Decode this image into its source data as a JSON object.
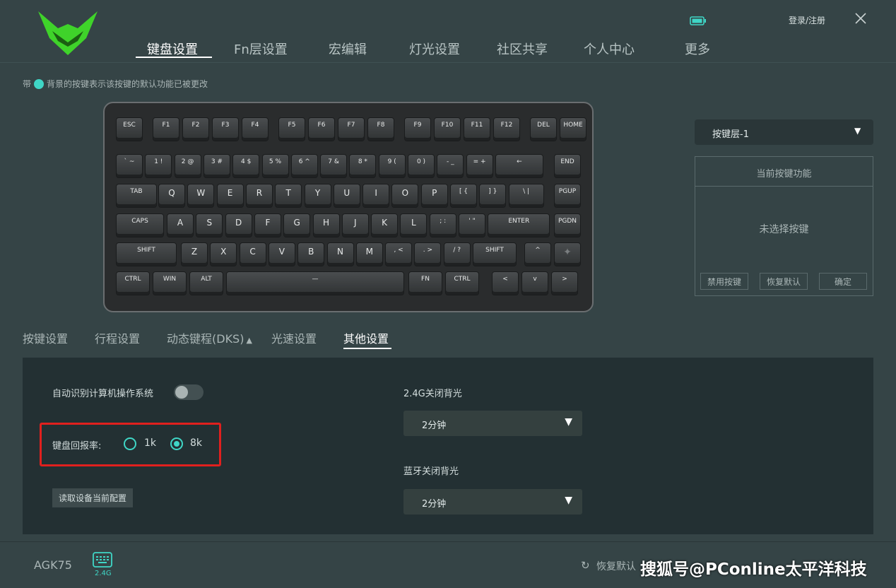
{
  "header": {
    "nav": [
      "键盘设置",
      "Fn层设置",
      "宏编辑",
      "灯光设置",
      "社区共享",
      "个人中心",
      "更多"
    ],
    "login": "登录/注册",
    "battery_icon": "battery-icon",
    "close_icon": "close-icon"
  },
  "hint": {
    "prefix": "带",
    "text": "背景的按键表示该按键的默认功能已被更改"
  },
  "keyboard": {
    "row0": [
      "ESC",
      "F1",
      "F2",
      "F3",
      "F4",
      "F5",
      "F6",
      "F7",
      "F8",
      "F9",
      "F10",
      "F11",
      "F12",
      "DEL",
      "HOME"
    ],
    "row1": [
      "` ~",
      "1 !",
      "2 @",
      "3 #",
      "4 $",
      "5 %",
      "6 ^",
      "7 &",
      "8 *",
      "9 (",
      "0 )",
      "- _",
      "= +",
      "←",
      "END"
    ],
    "row2": [
      "TAB",
      "Q",
      "W",
      "E",
      "R",
      "T",
      "Y",
      "U",
      "I",
      "O",
      "P",
      "[ {",
      "] }",
      "\\ |",
      "PGUP"
    ],
    "row3": [
      "CAPS",
      "A",
      "S",
      "D",
      "F",
      "G",
      "H",
      "J",
      "K",
      "L",
      "; :",
      "' \"",
      "ENTER",
      "PGDN"
    ],
    "row4": [
      "SHIFT",
      "Z",
      "X",
      "C",
      "V",
      "B",
      "N",
      "M",
      ", <",
      ". >",
      "/ ?",
      "SHIFT",
      "^"
    ],
    "row5": [
      "CTRL",
      "WIN",
      "ALT",
      "—",
      "FN",
      "CTRL",
      "<",
      "v",
      ">"
    ]
  },
  "right_panel": {
    "layer": "按键层-1",
    "func_title": "当前按键功能",
    "func_empty": "未选择按键",
    "btn_disable": "禁用按键",
    "btn_restore": "恢复默认",
    "btn_confirm": "确定"
  },
  "subtabs": [
    "按键设置",
    "行程设置",
    "动态键程(DKS)",
    "光速设置",
    "其他设置"
  ],
  "settings": {
    "auto_os": "自动识别计算机操作系统",
    "auto_os_on": false,
    "rate_label": "键盘回报率:",
    "rate_options": [
      "1k",
      "8k"
    ],
    "rate_selected": "8k",
    "read_config": "读取设备当前配置",
    "bl24_label": "2.4G关闭背光",
    "bl24_value": "2分钟",
    "bt_label": "蓝牙关闭背光",
    "bt_value": "2分钟"
  },
  "footer": {
    "model": "AGK75",
    "connection": "2.4G",
    "restore": "恢复默认",
    "watermark": "搜狐号@PConline太平洋科技"
  },
  "colors": {
    "accent": "#3fd6c6",
    "highlight_box": "#e0201e",
    "background": "#354446"
  }
}
